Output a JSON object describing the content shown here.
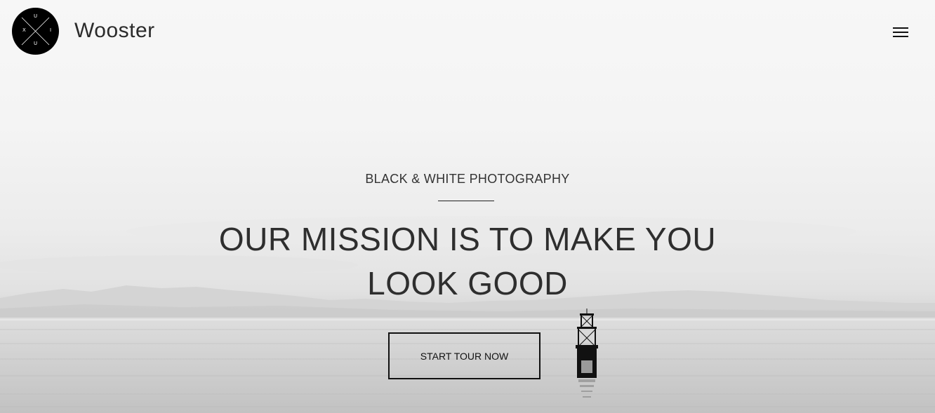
{
  "brand": {
    "logo_letters": {
      "top": "U",
      "left": "X",
      "right": "I",
      "bottom": "U"
    },
    "name": "Wooster"
  },
  "header": {
    "menu_icon": "hamburger-menu-icon"
  },
  "hero": {
    "eyebrow": "BLACK & WHITE PHOTOGRAPHY",
    "headline": "OUR MISSION IS TO MAKE YOU LOOK GOOD",
    "cta_label": "START TOUR NOW"
  },
  "colors": {
    "logo_bg": "#000000",
    "text": "#2e2e2e",
    "accent_line": "#222222"
  }
}
